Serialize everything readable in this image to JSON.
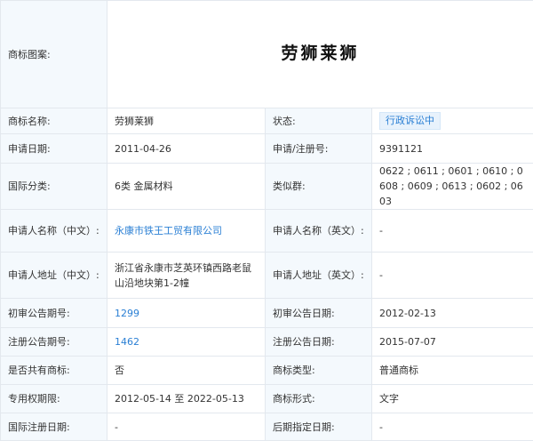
{
  "image_row": {
    "label": "商标图案:",
    "logo_text": "劳狮莱狮"
  },
  "rows": [
    {
      "l1": "商标名称:",
      "v1": "劳狮莱狮",
      "l2": "状态:",
      "v2": "行政诉讼中"
    },
    {
      "l1": "申请日期:",
      "v1": "2011-04-26",
      "l2": "申请/注册号:",
      "v2": "9391121"
    },
    {
      "l1": "国际分类:",
      "v1": "6类 金属材料",
      "l2": "类似群:",
      "v2": "0622 ; 0611 ; 0601 ; 0610 ; 0608 ; 0609 ; 0613 ; 0602 ; 0603"
    },
    {
      "l1": "申请人名称（中文）:",
      "v1": "永康市铁王工贸有限公司",
      "l2": "申请人名称（英文）:",
      "v2": "-"
    },
    {
      "l1": "申请人地址（中文）:",
      "v1": "浙江省永康市芝英环镇西路老鼠山沿地块第1-2幢",
      "l2": "申请人地址（英文）:",
      "v2": "-"
    },
    {
      "l1": "初审公告期号:",
      "v1": "1299",
      "l2": "初审公告日期:",
      "v2": "2012-02-13"
    },
    {
      "l1": "注册公告期号:",
      "v1": "1462",
      "l2": "注册公告日期:",
      "v2": "2015-07-07"
    },
    {
      "l1": "是否共有商标:",
      "v1": "否",
      "l2": "商标类型:",
      "v2": "普通商标"
    },
    {
      "l1": "专用权期限:",
      "v1": "2012-05-14 至 2022-05-13",
      "l2": "商标形式:",
      "v2": "文字"
    },
    {
      "l1": "国际注册日期:",
      "v1": "-",
      "l2": "后期指定日期:",
      "v2": "-"
    }
  ],
  "colors": {
    "label_bg": "#f4f9fd",
    "border": "#e3e8ee",
    "link": "#2a7fd4"
  }
}
